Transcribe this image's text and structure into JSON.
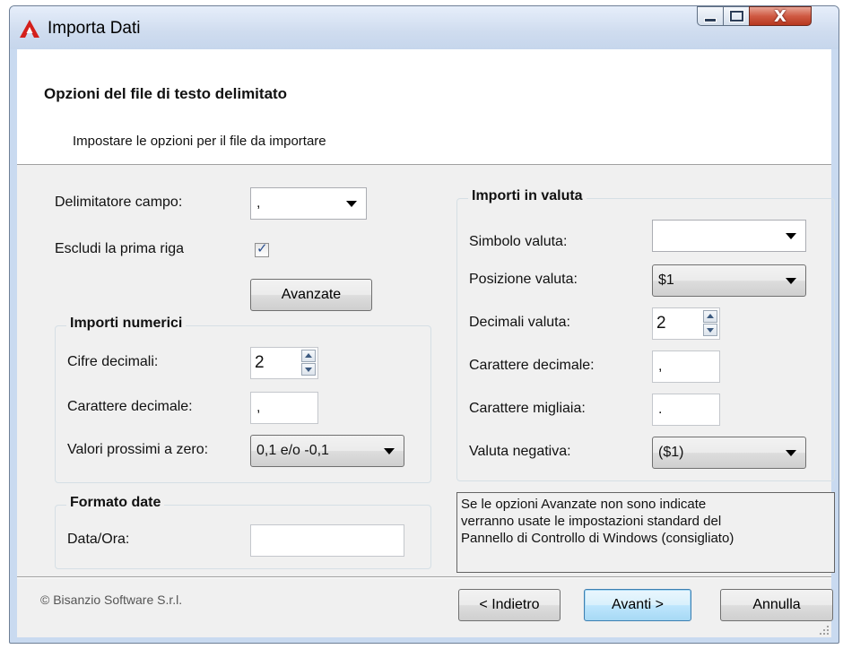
{
  "window": {
    "title": "Importa Dati",
    "close_glyph": "X",
    "icon": "red-a-logo-icon"
  },
  "header": {
    "title": "Opzioni del file di testo delimitato",
    "subtitle": "Impostare le opzioni per il file da importare"
  },
  "left": {
    "delimiter_label": "Delimitatore campo:",
    "delimiter_value": ",",
    "skip_first_row_label": "Escludi la prima riga",
    "skip_first_row_checked": true,
    "check_glyph": "✓",
    "advanced_button": "Avanzate"
  },
  "numeric": {
    "title": "Importi numerici",
    "decimals_label": "Cifre decimali:",
    "decimals_value": "2",
    "decimal_char_label": "Carattere decimale:",
    "decimal_char_value": ",",
    "near_zero_label": "Valori prossimi a zero:",
    "near_zero_value": "0,1 e/o -0,1"
  },
  "dates": {
    "title": "Formato date",
    "datetime_label": "Data/Ora:",
    "datetime_value": ""
  },
  "currency": {
    "title": "Importi in valuta",
    "symbol_label": "Simbolo valuta:",
    "symbol_value": "",
    "position_label": "Posizione valuta:",
    "position_value": "$1",
    "decimals_label": "Decimali valuta:",
    "decimals_value": "2",
    "decimal_char_label": "Carattere decimale:",
    "decimal_char_value": ",",
    "thousands_char_label": "Carattere migliaia:",
    "thousands_char_value": ".",
    "negative_label": "Valuta negativa:",
    "negative_value": "($1)"
  },
  "note": {
    "line1": "Se le opzioni Avanzate non sono indicate",
    "line2": "verranno usate le impostazioni standard del",
    "line3": "Pannello di Controllo di Windows (consigliato)"
  },
  "footer": {
    "copyright": "© Bisanzio Software S.r.l.",
    "back_button": "< Indietro",
    "next_button": "Avanti >",
    "cancel_button": "Annulla"
  }
}
